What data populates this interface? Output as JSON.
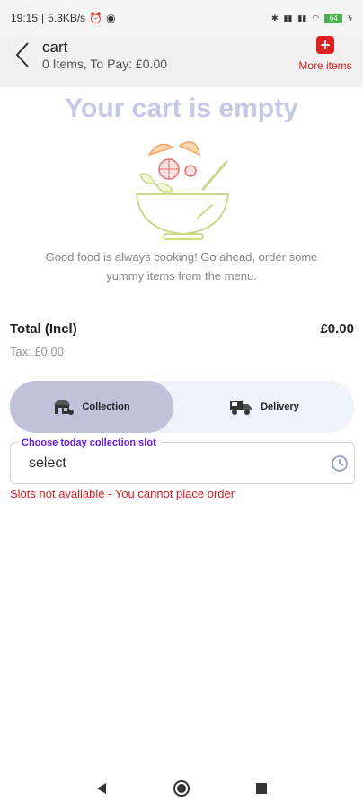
{
  "status_bar": {
    "time": "19:15",
    "network_speed": "5.3KB/s",
    "battery": "64"
  },
  "header": {
    "title": "cart",
    "subtitle": "0 Items, To Pay: £0.00",
    "more_items_label": "More items"
  },
  "empty_state": {
    "title": "Your cart is empty",
    "message": "Good food is always cooking! Go ahead, order some yummy items from the menu."
  },
  "summary": {
    "total_label": "Total (Incl)",
    "total_value": "£0.00",
    "tax_label": "Tax: £0.00"
  },
  "order_mode": {
    "collection_label": "Collection",
    "delivery_label": "Delivery",
    "selected": "Collection"
  },
  "slot": {
    "legend": "Choose today collection slot",
    "value": "select",
    "error": "Slots not available - You cannot place order"
  },
  "colors": {
    "accent_red": "#d32020",
    "legend_purple": "#6a1ae0",
    "toggle_selected": "#bfc2d9",
    "empty_title": "#c7c9e4"
  },
  "icons": {
    "back": "chevron-left-icon",
    "more": "plus-square-icon",
    "collection": "shop-icon",
    "delivery": "truck-icon",
    "slot": "clock-icon"
  }
}
